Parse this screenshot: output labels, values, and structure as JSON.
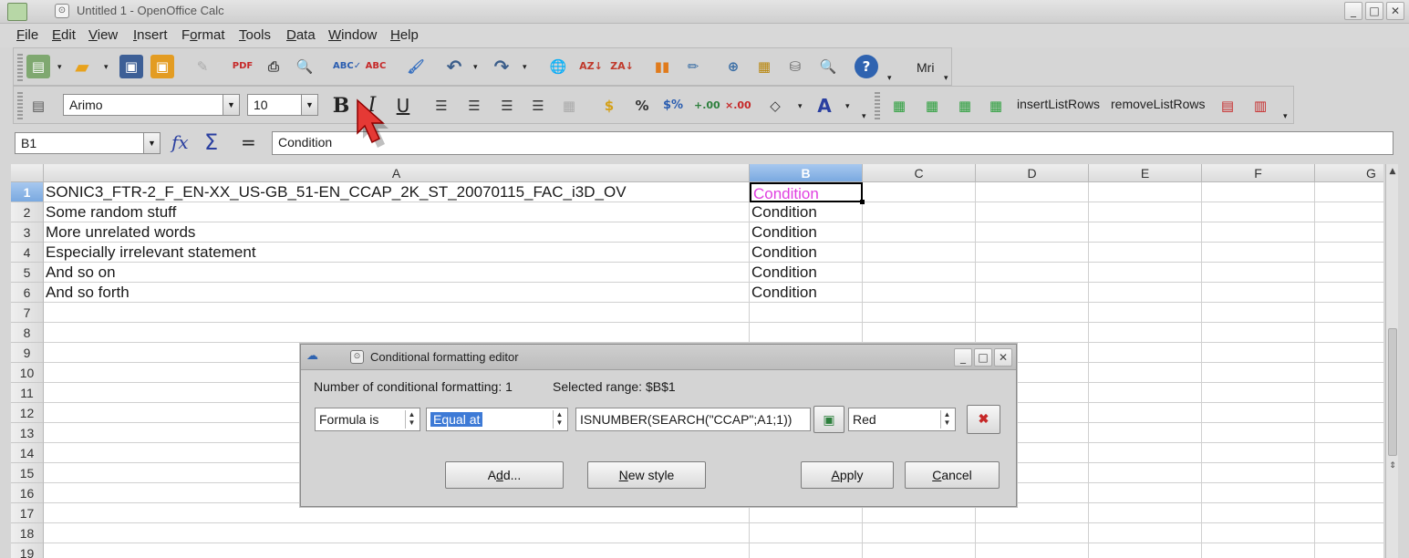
{
  "window": {
    "title": "Untitled 1 - OpenOffice Calc",
    "minimize": "_",
    "maximize": "□",
    "close": "✕"
  },
  "menu": [
    "File",
    "Edit",
    "View",
    "Insert",
    "Format",
    "Tools",
    "Data",
    "Window",
    "Help"
  ],
  "toolbar1": {
    "mri_label": "Mri"
  },
  "toolbar2": {
    "font_name": "Arimo",
    "font_size": "10",
    "bold": "B",
    "italic": "I",
    "underline": "U",
    "insert_list_rows": "insertListRows",
    "remove_list_rows": "removeListRows"
  },
  "formula_bar": {
    "name_box": "B1",
    "fx": "fx",
    "sum": "Σ",
    "equals": "=",
    "content": "Condition"
  },
  "sheet": {
    "columns": [
      "A",
      "B",
      "C",
      "D",
      "E",
      "F",
      "G"
    ],
    "active_cell": "B1",
    "rows": [
      {
        "num": "1",
        "a": "SONIC3_FTR-2_F_EN-XX_US-GB_51-EN_CCAP_2K_ST_20070115_FAC_i3D_OV",
        "b": "Condition"
      },
      {
        "num": "2",
        "a": "Some random stuff",
        "b": "Condition"
      },
      {
        "num": "3",
        "a": "More unrelated words",
        "b": "Condition"
      },
      {
        "num": "4",
        "a": "Especially irrelevant statement",
        "b": "Condition"
      },
      {
        "num": "5",
        "a": "And so on",
        "b": "Condition"
      },
      {
        "num": "6",
        "a": "And so forth",
        "b": "Condition"
      },
      {
        "num": "7",
        "a": "",
        "b": ""
      },
      {
        "num": "8",
        "a": "",
        "b": ""
      },
      {
        "num": "9",
        "a": "",
        "b": ""
      },
      {
        "num": "10",
        "a": "",
        "b": ""
      },
      {
        "num": "11",
        "a": "",
        "b": ""
      },
      {
        "num": "12",
        "a": "",
        "b": ""
      },
      {
        "num": "13",
        "a": "",
        "b": ""
      },
      {
        "num": "14",
        "a": "",
        "b": ""
      },
      {
        "num": "15",
        "a": "",
        "b": ""
      },
      {
        "num": "16",
        "a": "",
        "b": ""
      },
      {
        "num": "17",
        "a": "",
        "b": ""
      },
      {
        "num": "18",
        "a": "",
        "b": ""
      },
      {
        "num": "19",
        "a": "",
        "b": ""
      }
    ],
    "b1_color": "#e040e0"
  },
  "dialog": {
    "title": "Conditional formatting editor",
    "count_label": "Number of conditional formatting: 1",
    "range_label": "Selected range: $B$1",
    "condition_type": "Formula is",
    "operator": "Equal at",
    "formula": "ISNUMBER(SEARCH(\"CCAP\";A1;1))",
    "style": "Red",
    "add_button": "Add...",
    "new_style_button": "New style",
    "apply_button": "Apply",
    "cancel_button": "Cancel"
  }
}
